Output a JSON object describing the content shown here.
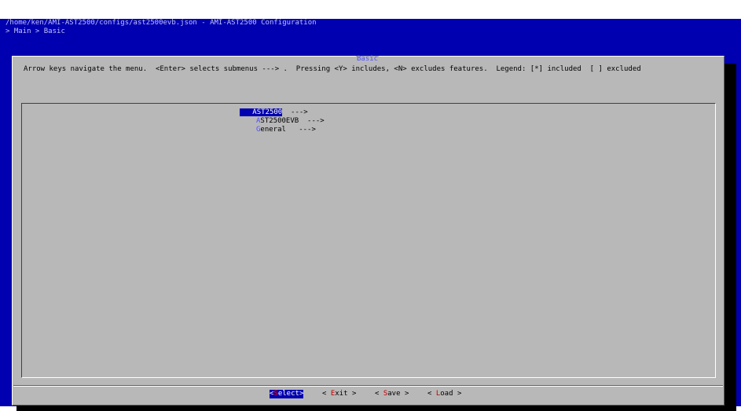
{
  "terminal": {
    "path_line": "/home/ken/AMI-AST2500/configs/ast2500evb.json - AMI-AST2500 Configuration",
    "breadcrumb": "> Main > Basic"
  },
  "dialog": {
    "title": "Basic",
    "help_text": "Arrow keys navigate the menu.  <Enter> selects submenus ---> .  Pressing <Y> includes, <N> excludes features.  Legend: [*] included  [ ] excluded"
  },
  "menu": {
    "items": [
      {
        "hotkey": "A",
        "label": "ST2500",
        "arrow": "--->",
        "selected": true
      },
      {
        "hotkey": "A",
        "label": "ST2500EVB",
        "arrow": "--->",
        "selected": false
      },
      {
        "hotkey": "G",
        "label": "eneral",
        "arrow": "--->",
        "selected": false
      }
    ]
  },
  "buttons": {
    "select": {
      "open": "<",
      "hotkey": "S",
      "rest": "elect",
      "close": ">"
    },
    "exit": {
      "open": "< ",
      "hotkey": "E",
      "rest": "xit",
      "close": " >"
    },
    "save": {
      "open": "< ",
      "hotkey": "S",
      "rest": "ave",
      "close": " >"
    },
    "load": {
      "open": "< ",
      "hotkey": "L",
      "rest": "oad",
      "close": " >"
    }
  },
  "colors": {
    "terminal_bg": "#0000b0",
    "dialog_bg": "#b8b8b8",
    "title_color": "#5050ff",
    "hotkey_color": "#c00000"
  }
}
